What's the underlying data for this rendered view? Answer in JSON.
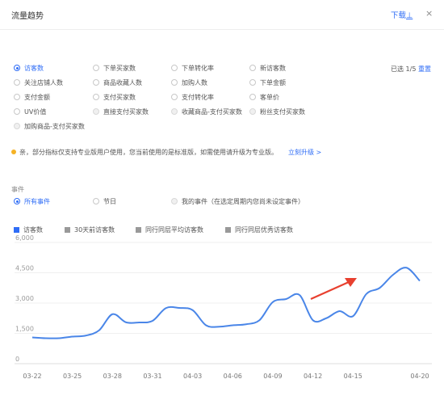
{
  "header": {
    "title": "流量趋势",
    "download_label": "下载",
    "download_suffix": "⊥",
    "close_label": "×"
  },
  "metrics": {
    "selected_info": "已选 1/5",
    "reset_label": "重置",
    "options": [
      {
        "label": "访客数",
        "checked": true,
        "disabled": false
      },
      {
        "label": "下单买家数",
        "checked": false,
        "disabled": false
      },
      {
        "label": "下单转化率",
        "checked": false,
        "disabled": false
      },
      {
        "label": "新访客数",
        "checked": false,
        "disabled": false
      },
      {
        "label": "关注店铺人数",
        "checked": false,
        "disabled": false
      },
      {
        "label": "商品收藏人数",
        "checked": false,
        "disabled": false
      },
      {
        "label": "加购人数",
        "checked": false,
        "disabled": false
      },
      {
        "label": "下单金额",
        "checked": false,
        "disabled": false
      },
      {
        "label": "支付金额",
        "checked": false,
        "disabled": false
      },
      {
        "label": "支付买家数",
        "checked": false,
        "disabled": false
      },
      {
        "label": "支付转化率",
        "checked": false,
        "disabled": false
      },
      {
        "label": "客单价",
        "checked": false,
        "disabled": false
      },
      {
        "label": "UV价值",
        "checked": false,
        "disabled": false
      },
      {
        "label": "直接支付买家数",
        "checked": false,
        "disabled": true
      },
      {
        "label": "收藏商品-支付买家数",
        "checked": false,
        "disabled": true
      },
      {
        "label": "粉丝支付买家数",
        "checked": false,
        "disabled": true
      },
      {
        "label": "加购商品-支付买家数",
        "checked": false,
        "disabled": true
      }
    ]
  },
  "notice": {
    "text": "亲，部分指标仅支持专业版用户使用，您当前使用的是标准版，如需使用请升级为专业版。",
    "link": "立刻升级 >"
  },
  "events": {
    "section_label": "事件",
    "options": [
      {
        "label": "所有事件",
        "checked": true,
        "disabled": false
      },
      {
        "label": "节日",
        "checked": false,
        "disabled": false
      },
      {
        "label": "我的事件（在选定周期内您尚未设定事件）",
        "checked": false,
        "disabled": true
      }
    ]
  },
  "colors": {
    "accent": "#2f6df6",
    "line": "#4a86e8",
    "legend_gray": "#999999",
    "arrow": "#e8402f"
  },
  "annotation": {
    "type": "arrow",
    "color": "#e8402f"
  },
  "chart_data": {
    "type": "line",
    "legend": [
      {
        "name": "访客数",
        "color": "#2f6df6"
      },
      {
        "name": "30天前访客数",
        "color": "#999999"
      },
      {
        "name": "同行同层平均访客数",
        "color": "#999999"
      },
      {
        "name": "同行同层优秀访客数",
        "color": "#999999"
      }
    ],
    "y_ticks": [
      "6,000",
      "4,500",
      "3,000",
      "1,500",
      "0"
    ],
    "ylim": [
      0,
      6000
    ],
    "x_ticks": [
      "03-22",
      "03-25",
      "03-28",
      "03-31",
      "04-03",
      "04-06",
      "04-09",
      "04-12",
      "04-15",
      "04-20"
    ],
    "grid": true,
    "series": [
      {
        "name": "访客数",
        "x": [
          "03-22",
          "03-23",
          "03-24",
          "03-25",
          "03-26",
          "03-27",
          "03-28",
          "03-29",
          "03-30",
          "03-31",
          "04-01",
          "04-02",
          "04-03",
          "04-04",
          "04-05",
          "04-06",
          "04-07",
          "04-08",
          "04-09",
          "04-10",
          "04-11",
          "04-12",
          "04-13",
          "04-14",
          "04-15",
          "04-16",
          "04-17",
          "04-18",
          "04-19",
          "04-20"
        ],
        "values": [
          1300,
          1260,
          1260,
          1340,
          1390,
          1650,
          2450,
          2050,
          2040,
          2120,
          2750,
          2760,
          2650,
          1900,
          1830,
          1900,
          1950,
          2150,
          3050,
          3200,
          3400,
          2150,
          2250,
          2600,
          2350,
          3450,
          3750,
          4400,
          4750,
          4100
        ]
      }
    ]
  }
}
